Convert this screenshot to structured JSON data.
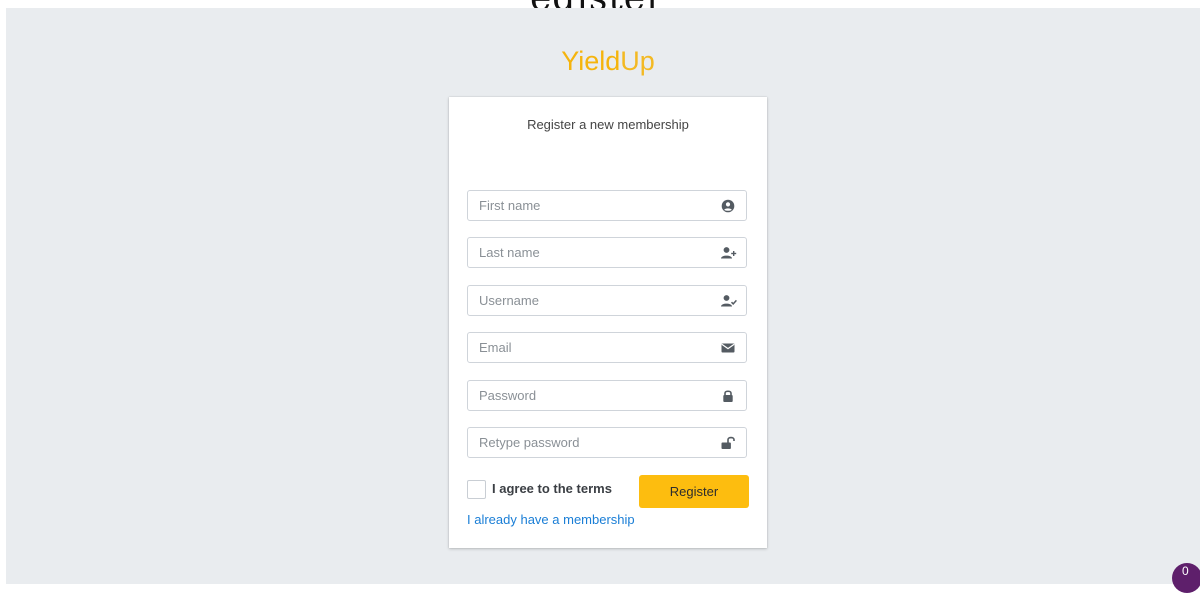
{
  "brand": {
    "name_strong": "Yield",
    "name_light": "Up",
    "color": "#f5b40d"
  },
  "top_fragment": "egister",
  "card": {
    "message": "Register a new membership"
  },
  "form": {
    "first_name": {
      "placeholder": "First name",
      "value": "",
      "icon": "user-circle-icon"
    },
    "last_name": {
      "placeholder": "Last name",
      "value": "",
      "icon": "user-plus-icon"
    },
    "username": {
      "placeholder": "Username",
      "value": "",
      "icon": "user-check-icon"
    },
    "email": {
      "placeholder": "Email",
      "value": "",
      "icon": "envelope-icon"
    },
    "password": {
      "placeholder": "Password",
      "value": "",
      "icon": "lock-icon"
    },
    "retype_password": {
      "placeholder": "Retype password",
      "value": "",
      "icon": "unlock-icon"
    },
    "agree_label": "I agree to the terms",
    "agree_checked": false,
    "register_label": "Register",
    "member_link": "I already have a membership"
  },
  "colors": {
    "accent": "#fdbd0f",
    "link": "#1a7ed6",
    "badge": "#5e1f6b",
    "background": "#e9ecef"
  },
  "badge": {
    "count": "0"
  }
}
